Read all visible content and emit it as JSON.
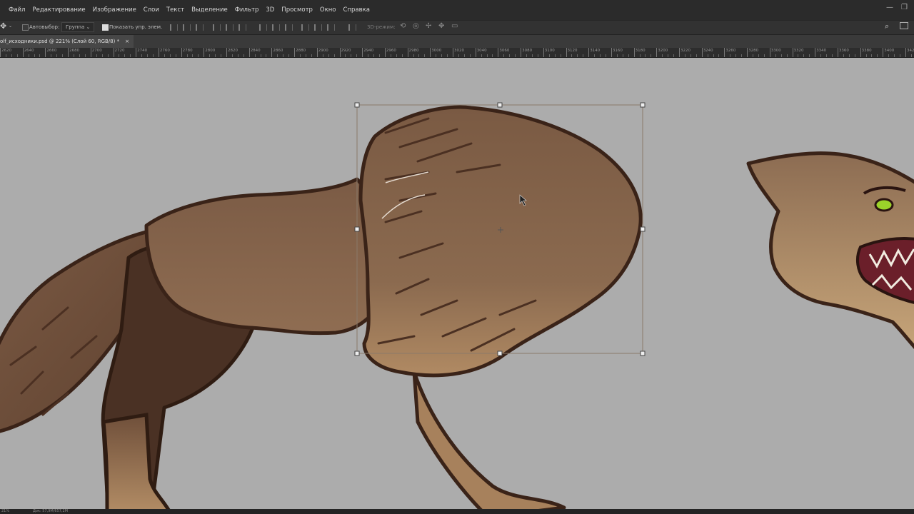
{
  "menu": [
    "Файл",
    "Редактирование",
    "Изображение",
    "Слои",
    "Текст",
    "Выделение",
    "Фильтр",
    "3D",
    "Просмотр",
    "Окно",
    "Справка"
  ],
  "window_controls": {
    "minimize": "—",
    "restore": "❐"
  },
  "options": {
    "autoselect_label": "Автовыбор:",
    "autoselect_checked": false,
    "group_value": "Группа",
    "show_transform_label": "Показать упр. элем.",
    "show_transform_checked": true,
    "mode_3d_label": "3D-режим:"
  },
  "document_tab": {
    "title": "olf_исходники.psd @ 221% (Слой 60, RGB/8) *",
    "close": "×"
  },
  "ruler": {
    "labels": [
      "2620",
      "2640",
      "2660",
      "2680",
      "2700",
      "2720",
      "2740",
      "2760",
      "2780",
      "2800",
      "2820",
      "2840",
      "2860",
      "2880",
      "2900",
      "2920",
      "2940",
      "2960",
      "2980",
      "3000",
      "3020",
      "3040",
      "3060",
      "3080",
      "3100",
      "3120",
      "3140",
      "3160",
      "3180",
      "3200",
      "3220",
      "3240",
      "3260",
      "3280",
      "3300",
      "3320",
      "3340",
      "3360",
      "3380",
      "3400",
      "3420"
    ]
  },
  "status": {
    "zoom": "21%",
    "doc_size": "Док: 57,9M/657,2M"
  },
  "colors": {
    "canvas": "#acacac",
    "menubar": "#2b2b2b",
    "fur_dark": "#6a4a36",
    "fur_light": "#8c6a50",
    "outline": "#3a2318",
    "eye": "#9bd22a"
  },
  "icons": [
    "move-tool-icon",
    "dropdown-arrow-icon",
    "align-icons",
    "distribute-icons",
    "3d-tool-icons",
    "search-icon",
    "workspace-icon"
  ]
}
